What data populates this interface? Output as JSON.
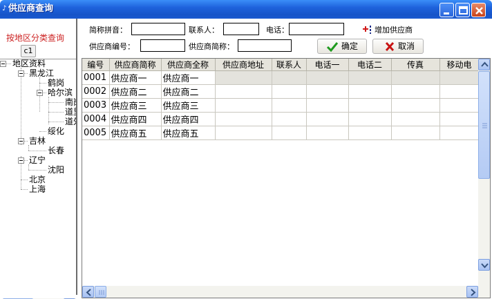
{
  "window": {
    "title": "供应商查询"
  },
  "left": {
    "region_title": "按地区分类查询",
    "tooltip": "c1",
    "tree": [
      {
        "label": "地区资料"
      },
      {
        "label": "黑龙江"
      },
      {
        "label": "鹤岗"
      },
      {
        "label": "哈尔滨"
      },
      {
        "label": "南岗"
      },
      {
        "label": "道里"
      },
      {
        "label": "道外"
      },
      {
        "label": "绥化"
      },
      {
        "label": "吉林"
      },
      {
        "label": "长春"
      },
      {
        "label": "辽宁"
      },
      {
        "label": "沈阳"
      },
      {
        "label": "北京"
      },
      {
        "label": "上海"
      }
    ]
  },
  "form": {
    "pinyin_label": "简称拼音：",
    "pinyin_value": "",
    "contact_label": "联系人：",
    "contact_value": "",
    "phone_label": "电话：",
    "phone_value": "",
    "add_supplier_label": "增加供应商",
    "code_label": "供应商编号：",
    "code_value": "",
    "short_name_label": "供应商简称：",
    "short_name_value": "",
    "confirm_label": "确定",
    "cancel_label": "取消"
  },
  "grid": {
    "columns": [
      "编号",
      "供应商简称",
      "供应商全称",
      "供应商地址",
      "联系人",
      "电话一",
      "电话二",
      "传真",
      "移动电"
    ],
    "rows": [
      [
        "0001",
        "供应商一",
        "供应商一"
      ],
      [
        "0002",
        "供应商二",
        "供应商二"
      ],
      [
        "0003",
        "供应商三",
        "供应商三"
      ],
      [
        "0004",
        "供应商四",
        "供应商四"
      ],
      [
        "0005",
        "供应商五",
        "供应商五"
      ]
    ]
  }
}
